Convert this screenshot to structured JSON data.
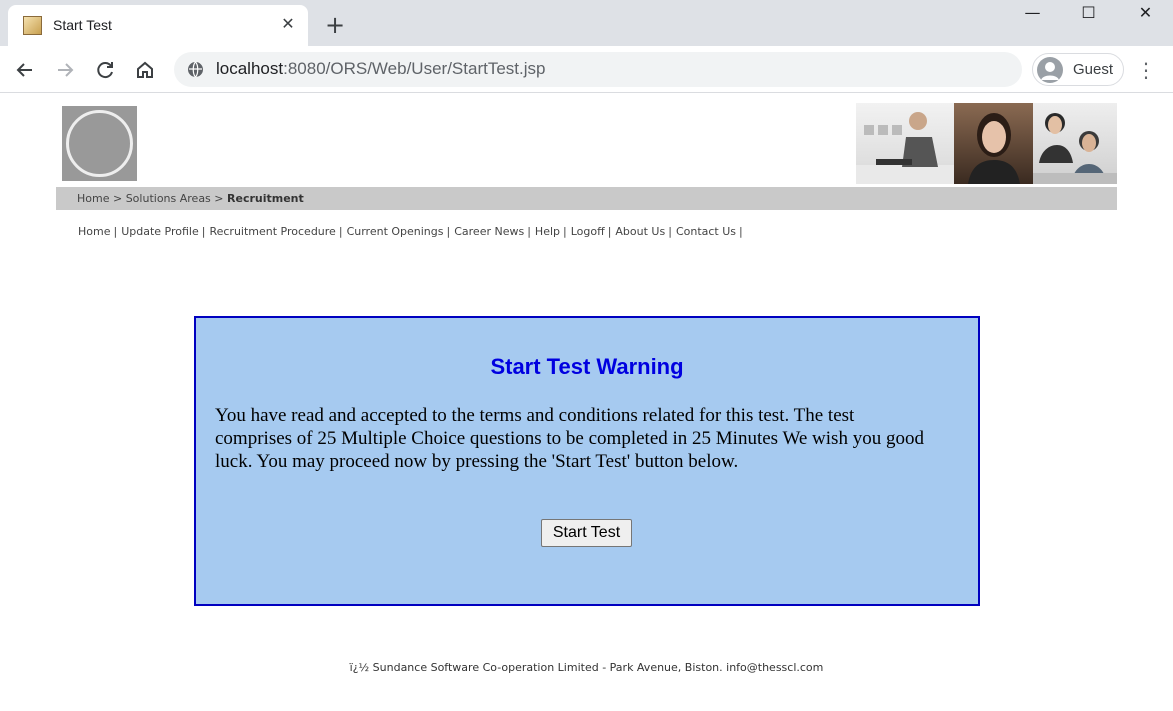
{
  "browser": {
    "tab_title": "Start Test",
    "tab_close": "✕",
    "new_tab": "+",
    "window_controls": {
      "minimize": "—",
      "maximize": "☐",
      "close": "✕"
    },
    "url_host": "localhost",
    "url_rest": ":8080/ORS/Web/User/StartTest.jsp",
    "profile_label": "Guest",
    "menu": "⋮"
  },
  "header": {
    "breadcrumb_home": "Home",
    "breadcrumb_sep1": " > ",
    "breadcrumb_solutions": "Solutions Areas",
    "breadcrumb_sep2": " > ",
    "breadcrumb_current": "Recruitment"
  },
  "nav": {
    "items": [
      "Home",
      "Update Profile",
      "Recruitment Procedure",
      "Current Openings",
      "Career News",
      "Help",
      "Logoff",
      "About Us",
      "Contact Us"
    ],
    "separator": "|"
  },
  "warning": {
    "title": "Start Test Warning",
    "text": "You have read and accepted to the terms and conditions related for this test. The test comprises of 25 Multiple Choice questions to be completed in 25 Minutes We wish you good luck. You may proceed now by pressing the 'Start Test' button below.",
    "button_label": "Start Test"
  },
  "footer": {
    "text": "ï¿½ Sundance Software Co-operation Limited - Park Avenue, Biston. info@thesscl.com"
  },
  "colors": {
    "box_background": "#a6caf0",
    "box_border": "#0000c0",
    "title_color": "#0000e0",
    "breadcrumb_bar": "#c9c9c9"
  }
}
